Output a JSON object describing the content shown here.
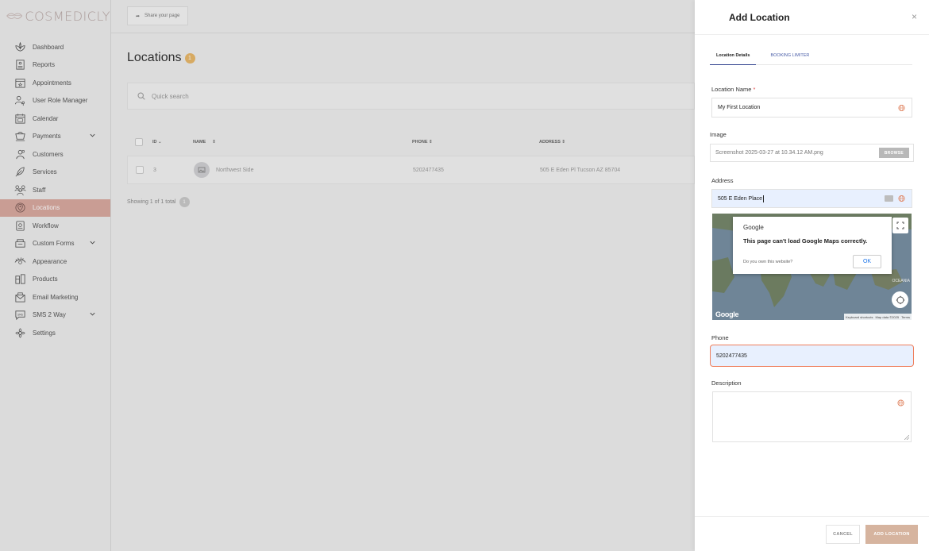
{
  "brand": {
    "name": "COSMEDICLY"
  },
  "sidebar": {
    "items": [
      {
        "label": "Dashboard",
        "icon": "lotus-icon"
      },
      {
        "label": "Reports",
        "icon": "report-icon"
      },
      {
        "label": "Appointments",
        "icon": "calendar-star-icon"
      },
      {
        "label": "User Role Manager",
        "icon": "user-key-icon"
      },
      {
        "label": "Calendar",
        "icon": "calendar-icon"
      },
      {
        "label": "Payments",
        "icon": "cart-icon",
        "expandable": true
      },
      {
        "label": "Customers",
        "icon": "customers-icon"
      },
      {
        "label": "Services",
        "icon": "feather-icon"
      },
      {
        "label": "Staff",
        "icon": "staff-icon"
      },
      {
        "label": "Locations",
        "icon": "location-pin-icon",
        "active": true
      },
      {
        "label": "Workflow",
        "icon": "workflow-icon"
      },
      {
        "label": "Custom Forms",
        "icon": "forms-icon",
        "expandable": true
      },
      {
        "label": "Appearance",
        "icon": "eye-icon"
      },
      {
        "label": "Products",
        "icon": "products-icon"
      },
      {
        "label": "Email Marketing",
        "icon": "email-icon"
      },
      {
        "label": "SMS 2 Way",
        "icon": "sms-icon",
        "expandable": true
      },
      {
        "label": "Settings",
        "icon": "flower-gear-icon"
      }
    ]
  },
  "topbar": {
    "share_label": "Share your page"
  },
  "locations_page": {
    "title": "Locations",
    "count": "1",
    "search_placeholder": "Quick search",
    "columns": {
      "id": "ID",
      "name": "NAME",
      "phone": "PHONE",
      "address": "ADDRESS"
    },
    "rows": [
      {
        "id": "3",
        "name": "Northwest Side",
        "phone": "5202477435",
        "address": "505 E Eden Pl Tucson AZ 85704"
      }
    ],
    "showing_text": "Showing 1 of 1 total",
    "page": "1"
  },
  "drawer": {
    "title": "Add Location",
    "close": "×",
    "tabs": {
      "details": "Location Details",
      "limiter": "BOOKING LIMITER"
    },
    "fields": {
      "name_label": "Location Name",
      "name_required": "*",
      "name_value": "My First Location",
      "image_label": "Image",
      "image_file": "Screenshot 2025-03-27 at 10.34.12 AM.png",
      "browse_label": "BROWSE",
      "address_label": "Address",
      "address_value": "505 E Eden Place",
      "phone_label": "Phone",
      "phone_value": "5202477435",
      "description_label": "Description",
      "description_value": ""
    },
    "map": {
      "dialog_brand": "Google",
      "dialog_message": "This page can't load Google Maps correctly.",
      "dialog_own": "Do you own this website?",
      "dialog_ok": "OK",
      "logo_text": "Google",
      "footer_shortcuts": "Keyboard shortcuts",
      "footer_data": "Map data ©2025",
      "footer_terms": "Terms",
      "ocean_label": "OCEANIA"
    },
    "footer": {
      "cancel": "CANCEL",
      "add": "ADD LOCATION"
    }
  }
}
